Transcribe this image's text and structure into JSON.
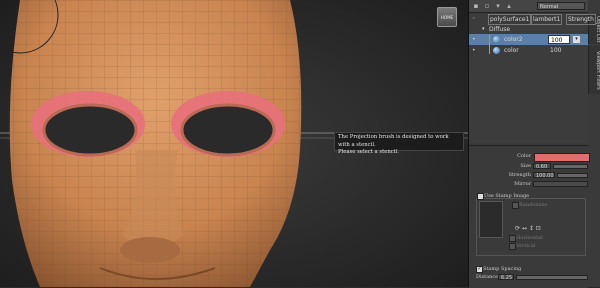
{
  "viewport": {
    "home_button_label": "HOME",
    "tooltip_line1": "The Projection brush is designed to work with a stencil.",
    "tooltip_line2": "Please select a stencil."
  },
  "toolbar": {
    "blend_mode": "Normal",
    "icons": [
      "new-layer-icon",
      "new-folder-icon",
      "delete-icon",
      "settings-icon"
    ]
  },
  "side_tabs": [
    "Object List",
    "Viewport Filters"
  ],
  "tree": {
    "object_name": "polySurface1",
    "material": "lambert1",
    "channel": "Strength",
    "group": "Diffuse",
    "layers": [
      {
        "name": "color2",
        "value": "100",
        "selected": true
      },
      {
        "name": "color",
        "value": "100",
        "selected": false
      }
    ]
  },
  "properties": {
    "color_label": "Color",
    "color_value": "#e26d6d",
    "size_label": "Size",
    "size_value": "0.60",
    "strength_label": "Strength",
    "strength_value": "100.00",
    "mirror_label": "Mirror",
    "use_stamp_label": "Use Stamp Image",
    "randomize_label": "Randomize",
    "horizontal_label": "Horizontal",
    "vertical_label": "Vertical",
    "stamp_spacing_label": "Stamp Spacing",
    "distance_label": "Distance",
    "distance_value": "6.25"
  }
}
